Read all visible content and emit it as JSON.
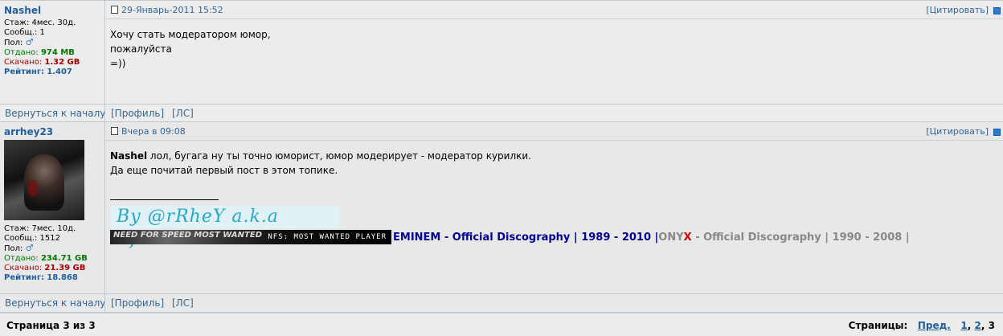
{
  "posts": [
    {
      "username": "Nashel",
      "stats": {
        "tenure": "Стаж: 4мес. 30д.",
        "posts": "Сообщ.: 1",
        "gender_label": "Пол:",
        "uploaded_label": "Отдано:",
        "uploaded": "974 MB",
        "downloaded_label": "Скачано:",
        "downloaded": "1.32 GB",
        "rating_label": "Рейтинг:",
        "rating": "1.407"
      },
      "date": "29-Январь-2011 15:52",
      "quote": "[Цитировать]",
      "lines": [
        "Хочу стать модератором юмор,",
        "пожалуйста",
        "=))"
      ],
      "back": "Вернуться к началу",
      "profile": "[Профиль]",
      "pm": "[ЛС]"
    },
    {
      "username": "arrhey23",
      "stats": {
        "tenure": "Стаж: 7мес. 10д.",
        "posts": "Сообщ.: 1512",
        "gender_label": "Пол:",
        "uploaded_label": "Отдано:",
        "uploaded": "234.71 GB",
        "downloaded_label": "Скачано:",
        "downloaded": "21.39 GB",
        "rating_label": "Рейтинг:",
        "rating": "18.868"
      },
      "date": "Вчера в 09:08",
      "quote": "[Цитировать]",
      "reply_name": "Nashel",
      "line1": " лол, бугага ну ты точно юморист, юмор модерирует - модератор курилки.",
      "line2": "Да еще почитай первый пост в этом топике.",
      "signature": {
        "banner": "By @rRheY a.k.a EfRiT",
        "nfs_text": "NFS: MOST WANTED PLAYER",
        "nfs_logo": "NEED FOR SPEED MOST WANTED",
        "eminem": "EMINEM - Official Discography | 1989 - 2010 |",
        "onyx_on": "ONY",
        "onyx_x": "X",
        "onyx_rest": " - Official Discography | 1990 - 2008 |"
      },
      "back": "Вернуться к началу",
      "profile": "[Профиль]",
      "pm": "[ЛС]"
    }
  ],
  "pagination": {
    "page_info": "Страница 3 из 3",
    "pages_label": "Страницы:",
    "prev": "Пред.",
    "p1": "1",
    "p2": "2",
    "p3": "3"
  }
}
